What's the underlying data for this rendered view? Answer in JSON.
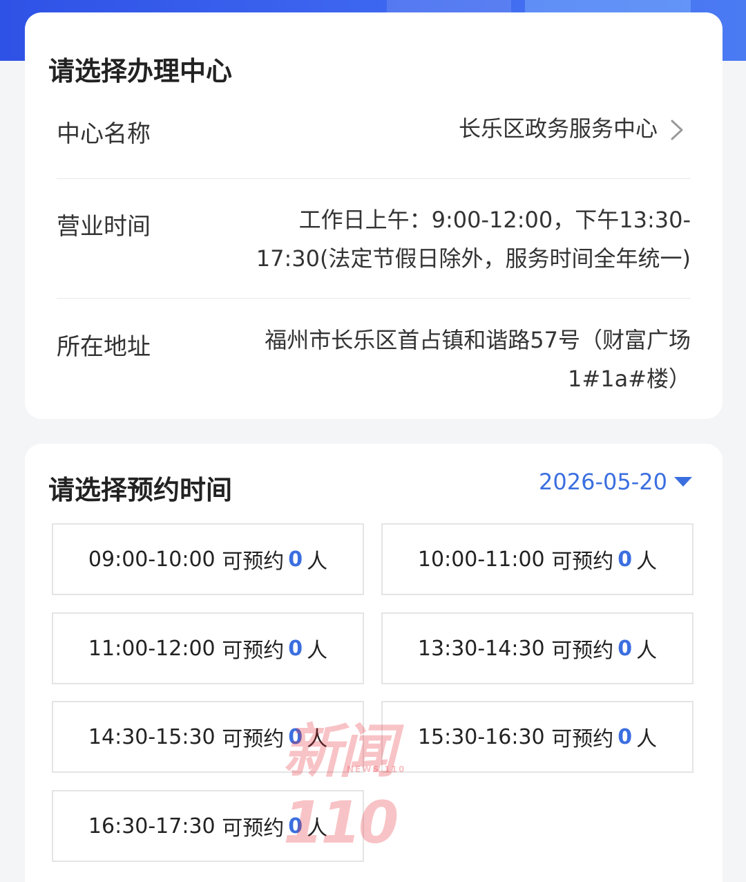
{
  "center_section": {
    "title": "请选择办理中心",
    "rows": [
      {
        "label": "中心名称",
        "value": "长乐区政务服务中心"
      },
      {
        "label": "营业时间",
        "value_line1": "工作日上午：9:00-12:00，下午13:30-",
        "value_line2": "17:30(法定节假日除外，服务时间全年统一)"
      },
      {
        "label": "所在地址",
        "value_line1": "福州市长乐区首占镇和谐路57号（财富广场",
        "value_line2": "1#1a#楼）"
      }
    ]
  },
  "time_section": {
    "title": "请选择预约时间",
    "date": "2026-05-20",
    "available_label": "可预约",
    "unit": "人",
    "slots": [
      {
        "time": "09:00-10:00",
        "count": "0"
      },
      {
        "time": "10:00-11:00",
        "count": "0"
      },
      {
        "time": "11:00-12:00",
        "count": "0"
      },
      {
        "time": "13:30-14:30",
        "count": "0"
      },
      {
        "time": "14:30-15:30",
        "count": "0"
      },
      {
        "time": "15:30-16:30",
        "count": "0"
      },
      {
        "time": "16:30-17:30",
        "count": "0"
      }
    ]
  },
  "watermark": {
    "text": "新闻110",
    "subtext": "NEWS 110"
  },
  "colors": {
    "accent": "#3b6fe0",
    "banner": "#3d66f0",
    "watermark": "#e62832"
  },
  "icons": {
    "chevron": "chevron-right-icon",
    "date_caret": "caret-down-icon"
  }
}
